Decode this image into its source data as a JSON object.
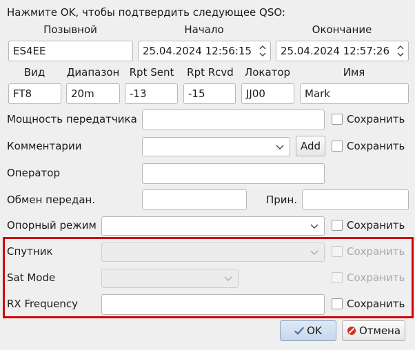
{
  "header": {
    "prompt": "Нажмите OK, чтобы подтвердить следующее QSO:"
  },
  "top_labels": {
    "callsign": "Позывной",
    "start": "Начало",
    "end": "Окончание"
  },
  "callsign_value": "ES4EE",
  "start_value": "25.04.2024 12:56:15",
  "end_value": "25.04.2024 12:57:26",
  "row2_labels": {
    "mode": "Вид",
    "band": "Диапазон",
    "rpt_sent": "Rpt Sent",
    "rpt_rcvd": "Rpt Rcvd",
    "locator": "Локатор",
    "name": "Имя"
  },
  "row2_values": {
    "mode": "FT8",
    "band": "20m",
    "rpt_sent": "-13",
    "rpt_rcvd": "-15",
    "locator": "JJ00",
    "name": "Mark"
  },
  "form": {
    "tx_power_label": "Мощность передатчика",
    "comments_label": "Комментарии",
    "add_button": "Add",
    "operator_label": "Оператор",
    "exch_sent_label": "Обмен передан.",
    "exch_rcvd_label": "Прин.",
    "prop_mode_label": "Опорный режим",
    "satellite_label": "Спутник",
    "sat_mode_label": "Sat Mode",
    "rx_freq_label": "RX Frequency",
    "save_label": "Сохранить"
  },
  "buttons": {
    "ok": "OK",
    "cancel": "Отмена"
  },
  "colors": {
    "highlight_box": "#d00000",
    "ok_icon": "#4a6fa5",
    "cancel_icon": "#d03020"
  },
  "icons": {
    "ok": "checkmark-icon",
    "cancel": "cancel-icon",
    "combo": "chevron-down-icon",
    "spin": "spin-updown-icon"
  }
}
